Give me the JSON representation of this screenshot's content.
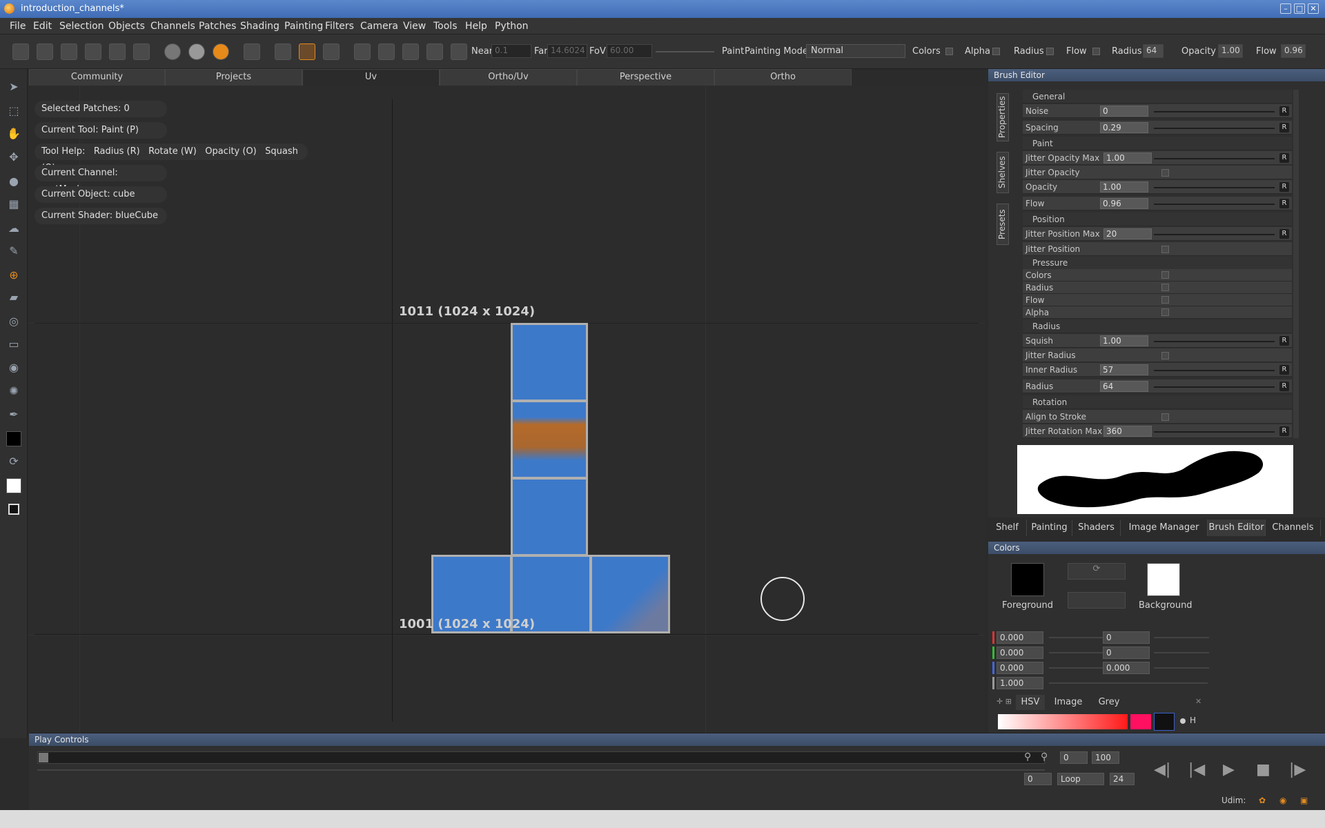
{
  "window": {
    "title": "introduction_channels*",
    "min": "–",
    "max": "□",
    "close": "✕"
  },
  "menu": [
    "File",
    "Edit",
    "Selection",
    "Objects",
    "Channels",
    "Patches",
    "Shading",
    "Painting",
    "Filters",
    "Camera",
    "View",
    "Tools",
    "Help",
    "Python"
  ],
  "toolbar": {
    "near_label": "Near",
    "near_value": "0.1",
    "far_label": "Far",
    "far_value": "14.6024",
    "fov_label": "FoV",
    "fov_value": "60.00",
    "paint_label": "Paint",
    "painting_mode_label": "Painting Mode",
    "painting_mode_value": "Normal",
    "colors_label": "Colors",
    "alpha_label": "Alpha",
    "radius_label": "Radius",
    "flow_label": "Flow",
    "radius2_label": "Radius",
    "radius2_value": "64",
    "opacity_label": "Opacity",
    "opacity_value": "1.00",
    "flow2_label": "Flow",
    "flow2_value": "0.96"
  },
  "tabs": [
    "Community",
    "Projects",
    "Uv",
    "Ortho/Uv",
    "Perspective",
    "Ortho"
  ],
  "viewport": {
    "info": [
      "Selected Patches: 0",
      "Current Tool: Paint (P)",
      "Current Channel: rustMask",
      "Current Object: cube",
      "Current Shader: blueCube"
    ],
    "tool_help": {
      "label": "Tool Help:",
      "radius": "Radius (R)",
      "rotate": "Rotate (W)",
      "opacity": "Opacity (O)",
      "squash": "Squash (Q)"
    },
    "uv_label_top": "1011 (1024 x 1024)",
    "uv_label_bottom": "1001 (1024 x 1024)"
  },
  "brush_editor": {
    "title": "Brush Editor",
    "side_tabs": [
      "Properties",
      "Shelves",
      "Presets"
    ],
    "sections": {
      "general": "General",
      "paint": "Paint",
      "position": "Position",
      "pressure": "Pressure",
      "radius": "Radius",
      "rotation": "Rotation"
    },
    "noise": {
      "label": "Noise",
      "value": "0"
    },
    "spacing": {
      "label": "Spacing",
      "value": "0.29"
    },
    "jitter_opacity_max": {
      "label": "Jitter Opacity Max",
      "value": "1.00"
    },
    "jitter_opacity": {
      "label": "Jitter Opacity"
    },
    "opacity": {
      "label": "Opacity",
      "value": "1.00"
    },
    "flow": {
      "label": "Flow",
      "value": "0.96"
    },
    "jitter_position_max": {
      "label": "Jitter Position Max",
      "value": "20"
    },
    "jitter_position": {
      "label": "Jitter Position"
    },
    "pressure_colors": {
      "label": "Colors"
    },
    "pressure_radius": {
      "label": "Radius"
    },
    "pressure_flow": {
      "label": "Flow"
    },
    "pressure_alpha": {
      "label": "Alpha"
    },
    "squish": {
      "label": "Squish",
      "value": "1.00"
    },
    "jitter_radius": {
      "label": "Jitter Radius"
    },
    "inner_radius": {
      "label": "Inner Radius",
      "value": "57"
    },
    "radius": {
      "label": "Radius",
      "value": "64"
    },
    "align_to_stroke": {
      "label": "Align to Stroke"
    },
    "jitter_rotation_max": {
      "label": "Jitter Rotation Max",
      "value": "360"
    },
    "reset": "R"
  },
  "bottom_tabs": [
    "Shelf",
    "Painting",
    "Shaders",
    "Image Manager",
    "Brush Editor",
    "Channels"
  ],
  "colors_panel": {
    "title": "Colors",
    "foreground": "Foreground",
    "background": "Background",
    "rgb": [
      "0.000",
      "0.000",
      "0.000"
    ],
    "alpha": "1.000",
    "hsv_left": [
      "0",
      "0",
      "0.000"
    ],
    "mode_tabs": [
      "HSV",
      "Image",
      "Grey"
    ],
    "h_label": "H",
    "fg_color": "#000000",
    "bg_color": "#ffffff",
    "hue_color": "#ff1060"
  },
  "play_controls": {
    "title": "Play Controls",
    "start": "0",
    "end": "100",
    "current": "0",
    "loop": "Loop",
    "fps": "24"
  },
  "status": {
    "udim": "Udim:"
  }
}
